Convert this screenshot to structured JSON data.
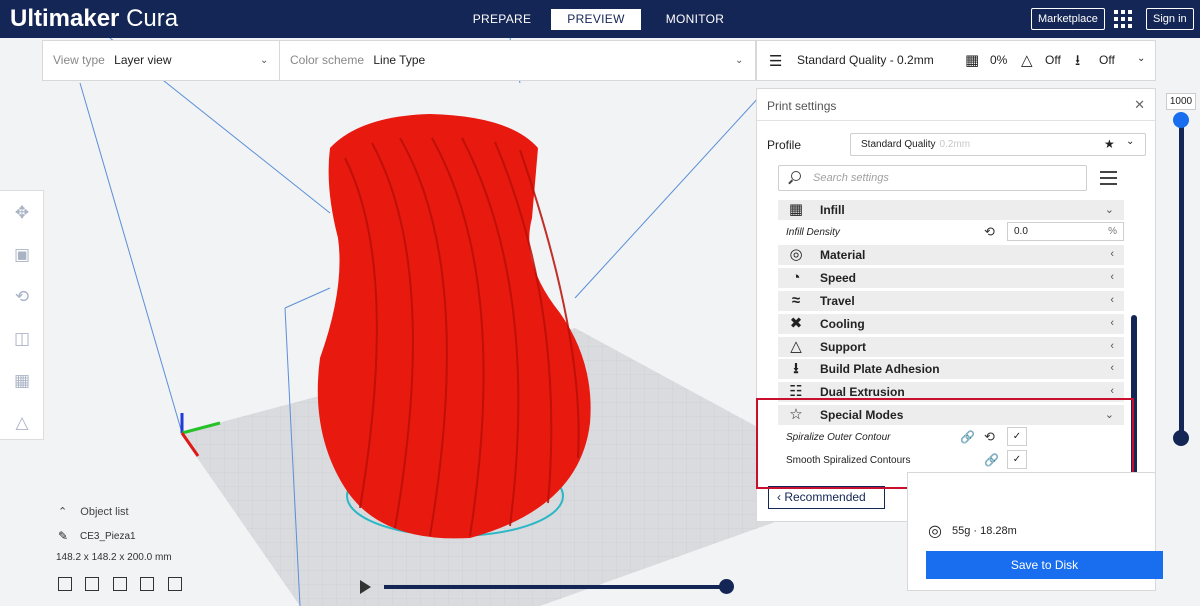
{
  "app": {
    "name_bold": "Ultimaker",
    "name_light": "Cura"
  },
  "stages": [
    {
      "label": "PREPARE"
    },
    {
      "label": "PREVIEW"
    },
    {
      "label": "MONITOR"
    }
  ],
  "header": {
    "marketplace_label": "Marketplace",
    "signin_label": "Sign in"
  },
  "view": {
    "view_type_label": "View type",
    "view_type_value": "Layer view",
    "color_scheme_label": "Color scheme",
    "color_scheme_value": "Line Type"
  },
  "quality_bar": {
    "profile": "Standard Quality - 0.2mm",
    "infill": "0%",
    "support": "Off",
    "adhesion": "Off"
  },
  "print_settings": {
    "title": "Print settings",
    "profile_label": "Profile",
    "profile_value": "Standard Quality",
    "profile_suffix": "0.2mm",
    "search_placeholder": "Search settings",
    "categories": [
      {
        "label": "Infill",
        "icon": "infill-icon",
        "expanded": true
      },
      {
        "label": "Material",
        "icon": "material-icon",
        "expanded": false
      },
      {
        "label": "Speed",
        "icon": "speed-icon",
        "expanded": false
      },
      {
        "label": "Travel",
        "icon": "travel-icon",
        "expanded": false
      },
      {
        "label": "Cooling",
        "icon": "cooling-icon",
        "expanded": false
      },
      {
        "label": "Support",
        "icon": "support-icon",
        "expanded": false
      },
      {
        "label": "Build Plate Adhesion",
        "icon": "adhesion-icon",
        "expanded": false
      },
      {
        "label": "Dual Extrusion",
        "icon": "dual-extrusion-icon",
        "expanded": false
      },
      {
        "label": "Special Modes",
        "icon": "star-icon",
        "expanded": true
      }
    ],
    "infill_density_label": "Infill Density",
    "infill_density_value": "0.0",
    "infill_density_unit": "%",
    "spiralize_label": "Spiralize Outer Contour",
    "spiralize_checked": true,
    "smooth_label": "Smooth Spiralized Contours",
    "smooth_checked": true,
    "recommended_label": "Recommended"
  },
  "action_panel": {
    "estimate": "55g · 18.28m",
    "save_label": "Save to Disk"
  },
  "layer_slider": {
    "value": "1000"
  },
  "object": {
    "list_label": "Object list",
    "name": "CE3_Pieza1",
    "dimensions": "148.2 x 148.2 x 200.0 mm"
  },
  "colors": {
    "header": "#142655",
    "accent": "#196ef0",
    "model": "#e8190f",
    "highlight_box": "#c8102e"
  }
}
